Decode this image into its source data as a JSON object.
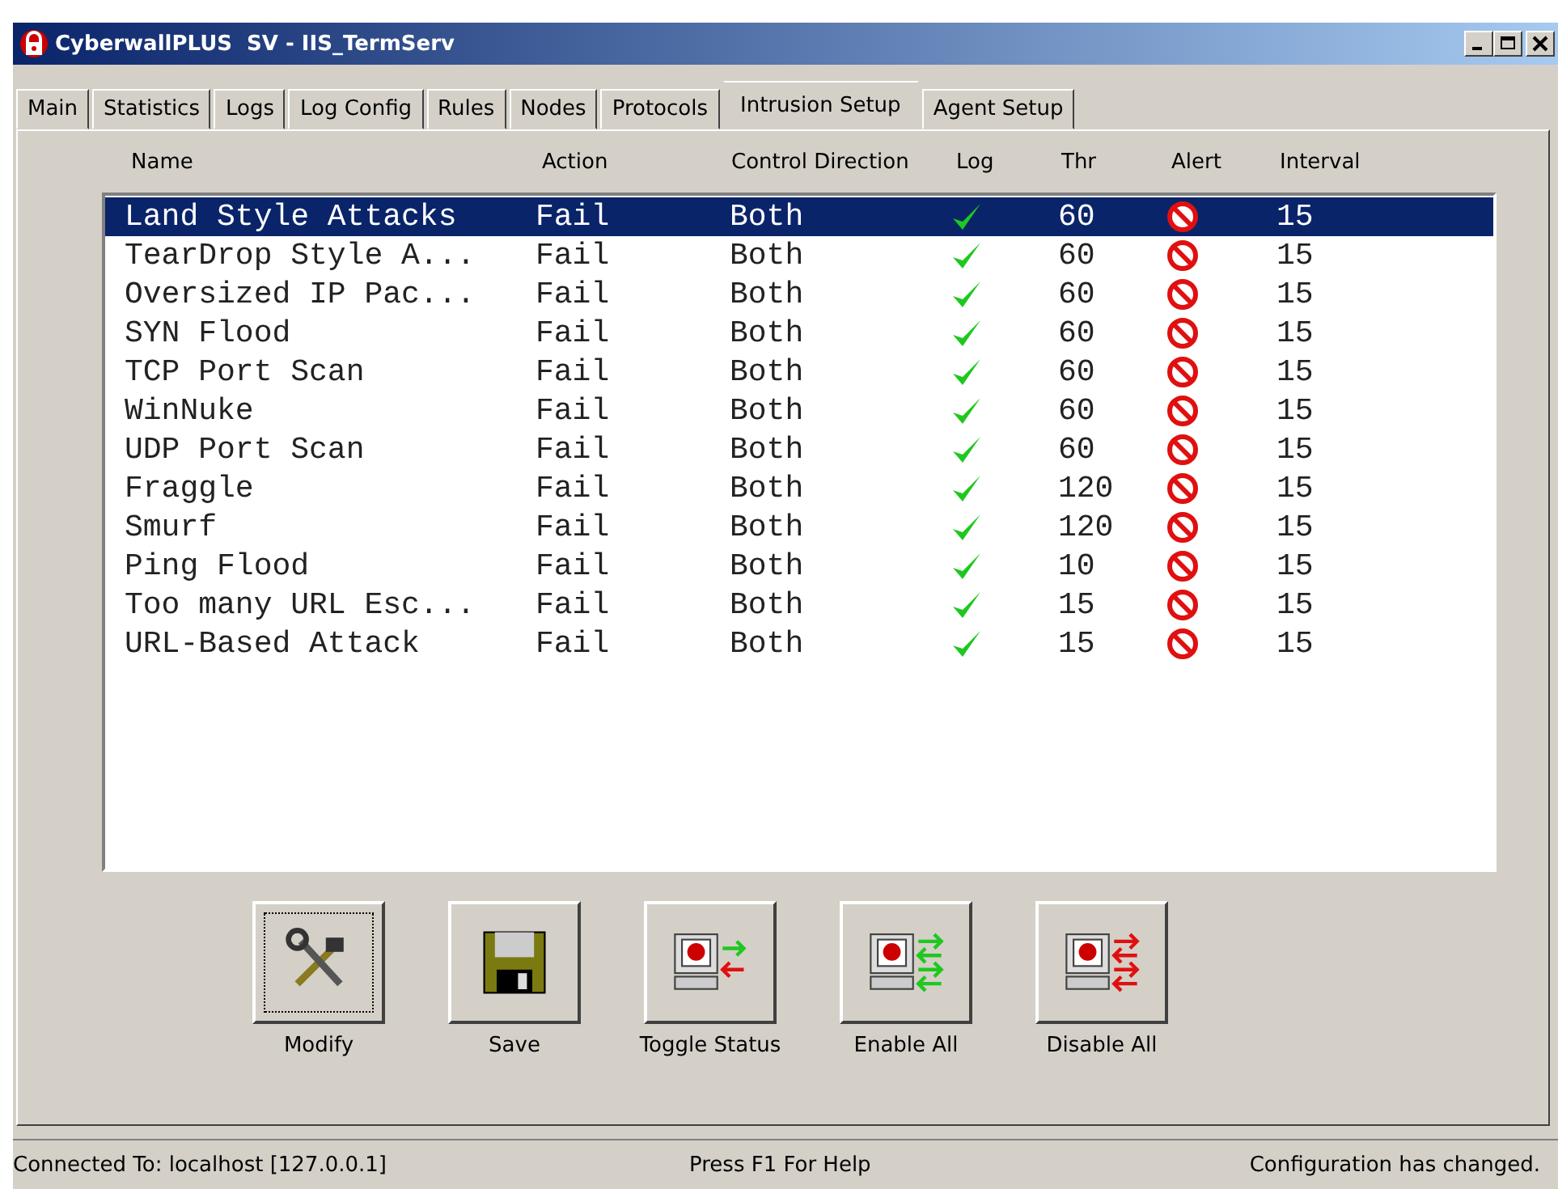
{
  "window": {
    "title": "CyberwallPLUS  SV - IIS_TermServ"
  },
  "tabs": [
    {
      "label": "Main",
      "selected": false
    },
    {
      "label": "Statistics",
      "selected": false
    },
    {
      "label": "Logs",
      "selected": false
    },
    {
      "label": "Log Config",
      "selected": false
    },
    {
      "label": "Rules",
      "selected": false
    },
    {
      "label": "Nodes",
      "selected": false
    },
    {
      "label": "Protocols",
      "selected": false
    },
    {
      "label": "Intrusion Setup",
      "selected": true
    },
    {
      "label": "Agent Setup",
      "selected": false
    }
  ],
  "table": {
    "columns": [
      "Name",
      "Action",
      "Control Direction",
      "Log",
      "Thr",
      "Alert",
      "Interval"
    ],
    "rows": [
      {
        "name": "Land Style Attacks",
        "action": "Fail",
        "direction": "Both",
        "log": true,
        "thr": "60",
        "alert": false,
        "interval": "15",
        "selected": true
      },
      {
        "name": "TearDrop Style A...",
        "action": "Fail",
        "direction": "Both",
        "log": true,
        "thr": "60",
        "alert": false,
        "interval": "15",
        "selected": false
      },
      {
        "name": "Oversized IP Pac...",
        "action": "Fail",
        "direction": "Both",
        "log": true,
        "thr": "60",
        "alert": false,
        "interval": "15",
        "selected": false
      },
      {
        "name": "SYN Flood",
        "action": "Fail",
        "direction": "Both",
        "log": true,
        "thr": "60",
        "alert": false,
        "interval": "15",
        "selected": false
      },
      {
        "name": "TCP Port Scan",
        "action": "Fail",
        "direction": "Both",
        "log": true,
        "thr": "60",
        "alert": false,
        "interval": "15",
        "selected": false
      },
      {
        "name": "WinNuke",
        "action": "Fail",
        "direction": "Both",
        "log": true,
        "thr": "60",
        "alert": false,
        "interval": "15",
        "selected": false
      },
      {
        "name": "UDP Port Scan",
        "action": "Fail",
        "direction": "Both",
        "log": true,
        "thr": "60",
        "alert": false,
        "interval": "15",
        "selected": false
      },
      {
        "name": "Fraggle",
        "action": "Fail",
        "direction": "Both",
        "log": true,
        "thr": "120",
        "alert": false,
        "interval": "15",
        "selected": false
      },
      {
        "name": "Smurf",
        "action": "Fail",
        "direction": "Both",
        "log": true,
        "thr": "120",
        "alert": false,
        "interval": "15",
        "selected": false
      },
      {
        "name": "Ping Flood",
        "action": "Fail",
        "direction": "Both",
        "log": true,
        "thr": "10",
        "alert": false,
        "interval": "15",
        "selected": false
      },
      {
        "name": "Too many URL Esc...",
        "action": "Fail",
        "direction": "Both",
        "log": true,
        "thr": "15",
        "alert": false,
        "interval": "15",
        "selected": false
      },
      {
        "name": "URL-Based Attack",
        "action": "Fail",
        "direction": "Both",
        "log": true,
        "thr": "15",
        "alert": false,
        "interval": "15",
        "selected": false
      }
    ]
  },
  "buttons": [
    {
      "kind": "modify",
      "label": "Modify"
    },
    {
      "kind": "save",
      "label": "Save"
    },
    {
      "kind": "toggle",
      "label": "Toggle Status"
    },
    {
      "kind": "enable",
      "label": "Enable All"
    },
    {
      "kind": "disable",
      "label": "Disable All"
    }
  ],
  "status_bar": {
    "connection": "Connected To: localhost [127.0.0.1]",
    "help": "Press F1 For Help",
    "message": "Configuration has changed."
  }
}
